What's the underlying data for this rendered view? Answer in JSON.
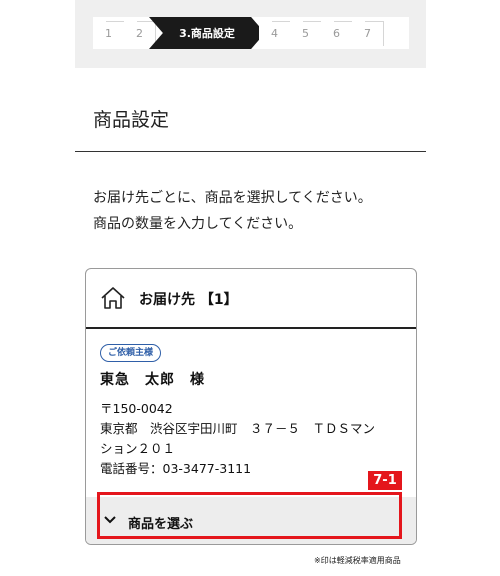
{
  "steps": [
    "1",
    "2",
    "3.商品設定",
    "4",
    "5",
    "6",
    "7"
  ],
  "page_title": "商品設定",
  "instructions": {
    "line1": "お届け先ごとに、商品を選択してください。",
    "line2": "商品の数量を入力してください。"
  },
  "card": {
    "title": "お届け先 【1】",
    "badge": "ご依頼主様",
    "name": "東急　太郎　様",
    "postal": "〒150-0042",
    "address1": "東京都　渋谷区宇田川町　３７－５　ＴＤＳマン",
    "address2": "ション２０１",
    "phone": "電話番号：03-3477-3111",
    "select_label": "商品を選ぶ"
  },
  "annotation": {
    "tag": "7-1",
    "color": "#e4161c"
  },
  "footnote": "※印は軽減税率適用商品",
  "icons": {
    "home": "home-icon",
    "chevron": "chevron-down-icon"
  }
}
